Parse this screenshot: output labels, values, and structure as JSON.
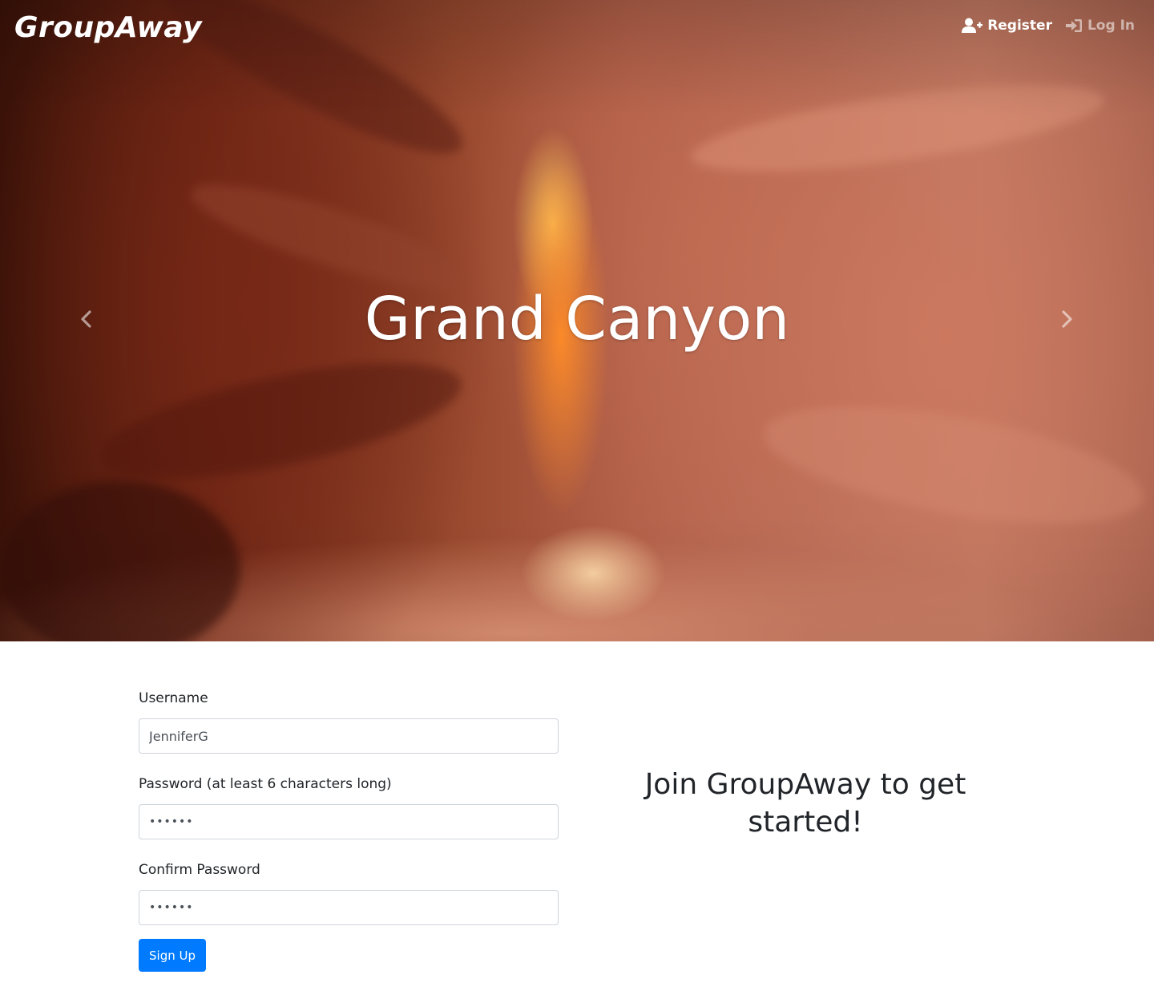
{
  "navbar": {
    "brand": "GroupAway",
    "register_label": "Register",
    "login_label": "Log In",
    "register_icon": "user-plus-icon",
    "login_icon": "sign-in-icon"
  },
  "carousel": {
    "slide_title": "Grand Canyon",
    "prev_icon": "chevron-left-icon",
    "next_icon": "chevron-right-icon"
  },
  "form": {
    "username_label": "Username",
    "username_value": "JenniferG",
    "password_label": "Password (at least 6 characters long)",
    "password_value": "••••••",
    "confirm_label": "Confirm Password",
    "confirm_value": "••••••",
    "submit_label": "Sign Up"
  },
  "join": {
    "message": "Join GroupAway to get started!"
  },
  "colors": {
    "primary": "#007bff",
    "text": "#212529",
    "input_border": "#ced4da"
  }
}
